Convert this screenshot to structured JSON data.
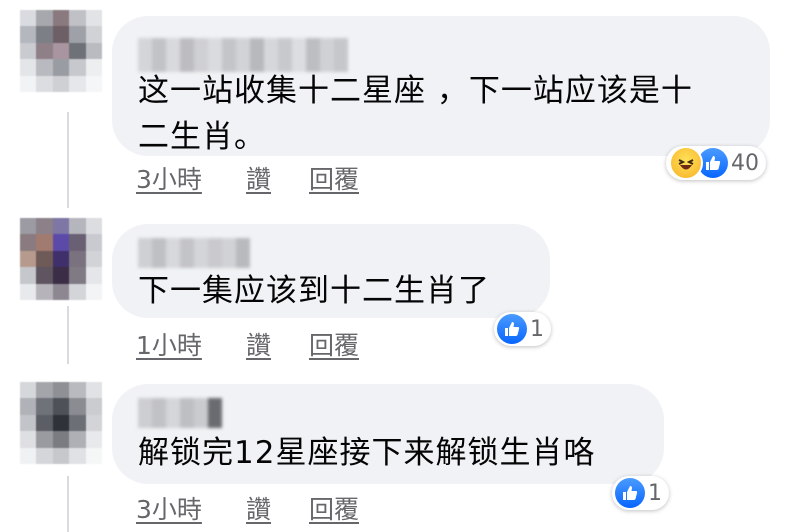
{
  "comments": [
    {
      "text_line1": "这一站收集十二星座 ，下一站应该是十",
      "text_line2": "二生肖。",
      "time": "3小時",
      "like": "讚",
      "reply": "回覆",
      "reaction_count": "40",
      "reaction_icons": [
        "haha-icon",
        "like-icon"
      ]
    },
    {
      "text_line1": "下一集应该到十二生肖了",
      "time": "1小時",
      "like": "讚",
      "reply": "回覆",
      "reaction_count": "1",
      "reaction_icons": [
        "like-icon"
      ]
    },
    {
      "text_line1": "解锁完12星座接下来解锁生肖咯",
      "time": "3小時",
      "like": "讚",
      "reply": "回覆",
      "reaction_count": "1",
      "reaction_icons": [
        "like-icon"
      ]
    }
  ],
  "colors": {
    "bubble": "#f0f2f5",
    "meta": "#65676b",
    "like_blue": "#0866ff",
    "haha_yellow": "#f7b125"
  }
}
